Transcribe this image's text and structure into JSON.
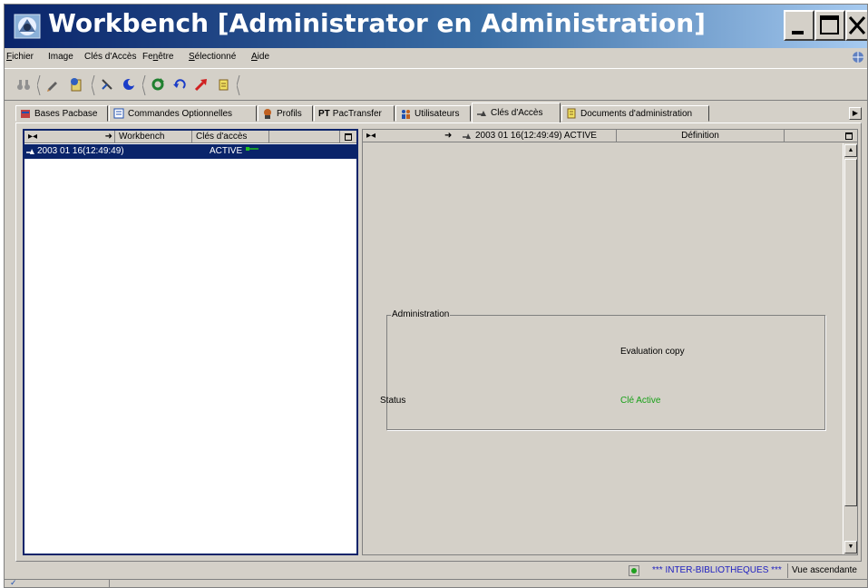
{
  "window": {
    "title": "Workbench [Administrator en Administration]"
  },
  "menu": [
    {
      "label": "Fichier",
      "mn": "F",
      "rest": "ichier"
    },
    {
      "label": "Image",
      "mn": "",
      "rest": "Image"
    },
    {
      "label": "Clés d'Accès",
      "mn": "",
      "rest": "Clés d'Accès"
    },
    {
      "label": "Fenêtre",
      "pre": "Fe",
      "mn": "n",
      "rest": "être"
    },
    {
      "label": "Sélectionné",
      "mn": "S",
      "rest": "électionné"
    },
    {
      "label": "Aide",
      "mn": "A",
      "rest": "ide"
    }
  ],
  "tabs": [
    {
      "label": "Bases Pacbase"
    },
    {
      "label": "Commandes Optionnelles"
    },
    {
      "label": "Profils"
    },
    {
      "label": "PT PacTransfer",
      "prefix": "PT",
      "text": "PacTransfer"
    },
    {
      "label": "Utilisateurs"
    },
    {
      "label": "Clés d'Accès",
      "active": true
    },
    {
      "label": "Documents d'administration"
    }
  ],
  "left_panel": {
    "header": {
      "col1": "Workbench",
      "col2": "Clés d'accès"
    },
    "rows": [
      {
        "date": "2003 01 16(12:49:49)",
        "status": "ACTIVE"
      }
    ]
  },
  "right_panel": {
    "header": {
      "col1": "2003 01 16(12:49:49) ACTIVE",
      "col2": "Définition"
    },
    "group": {
      "legend": "Administration",
      "eval_text": "Evaluation copy",
      "status_label": "Status",
      "status_value": "Clé Active",
      "status_color": "#18a018"
    }
  },
  "statusbar": {
    "library": "*** INTER-BIBLIOTHEQUES ***",
    "view": "Vue ascendante",
    "library_color": "#2020c0"
  },
  "colors": {
    "selection": "#0a246a",
    "face": "#d4d0c8"
  }
}
